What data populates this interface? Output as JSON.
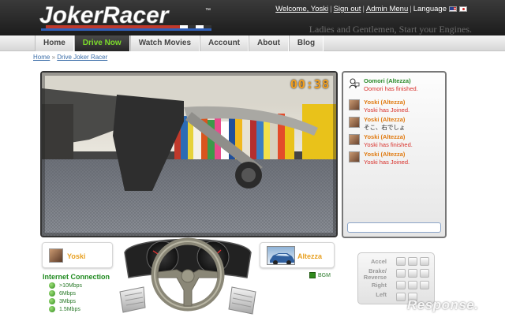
{
  "header": {
    "logo_text": "JokerRacer",
    "welcome": "Welcome, Yoski",
    "sign_out": "Sign out",
    "admin_menu": "Admin Menu",
    "language_label": "Language",
    "tagline": "Ladies and Gentlemen, Start your Engines."
  },
  "nav": {
    "items": [
      {
        "label": "Home"
      },
      {
        "label": "Drive Now"
      },
      {
        "label": "Watch Movies"
      },
      {
        "label": "Account"
      },
      {
        "label": "About"
      },
      {
        "label": "Blog"
      }
    ],
    "active": "Drive Now"
  },
  "breadcrumb": {
    "home": "Home",
    "separator": "»",
    "current": "Drive Joker Racer"
  },
  "video": {
    "timer": "00:38"
  },
  "chat": {
    "messages": [
      {
        "name": "Oomori (Altezza)",
        "text": "Oomori has finished.",
        "avatar": "agent-icon"
      },
      {
        "name": "Yoski (Altezza)",
        "text": "Yoski has Joined.",
        "avatar": "user-photo"
      },
      {
        "name": "Yoski (Altezza)",
        "text": "そこ、右でしょ",
        "avatar": "user-photo"
      },
      {
        "name": "Yoski (Altezza)",
        "text": "Yoski has finished.",
        "avatar": "user-photo"
      },
      {
        "name": "Yoski (Altezza)",
        "text": "Yoski has Joined.",
        "avatar": "user-photo"
      }
    ]
  },
  "player": {
    "name": "Yoski"
  },
  "car": {
    "name": "Altezza"
  },
  "connection": {
    "title": "Internet Connection",
    "options": [
      ">10Mbps",
      "6Mbps",
      "3Mbps",
      "1.5Mbps"
    ]
  },
  "bgm": {
    "label": "BGM",
    "checked": true
  },
  "controls": {
    "accel": "Accel",
    "brake": "Brake/",
    "reverse": "Reverse",
    "right": "Right",
    "left": "Left"
  },
  "watermark": "Response.",
  "colors": {
    "nav_active_text": "#7cdc2a",
    "timer": "#f3a020",
    "chat_orange": "#e07a10",
    "chat_red": "#d8302a",
    "chat_green": "#2a8a2a"
  }
}
